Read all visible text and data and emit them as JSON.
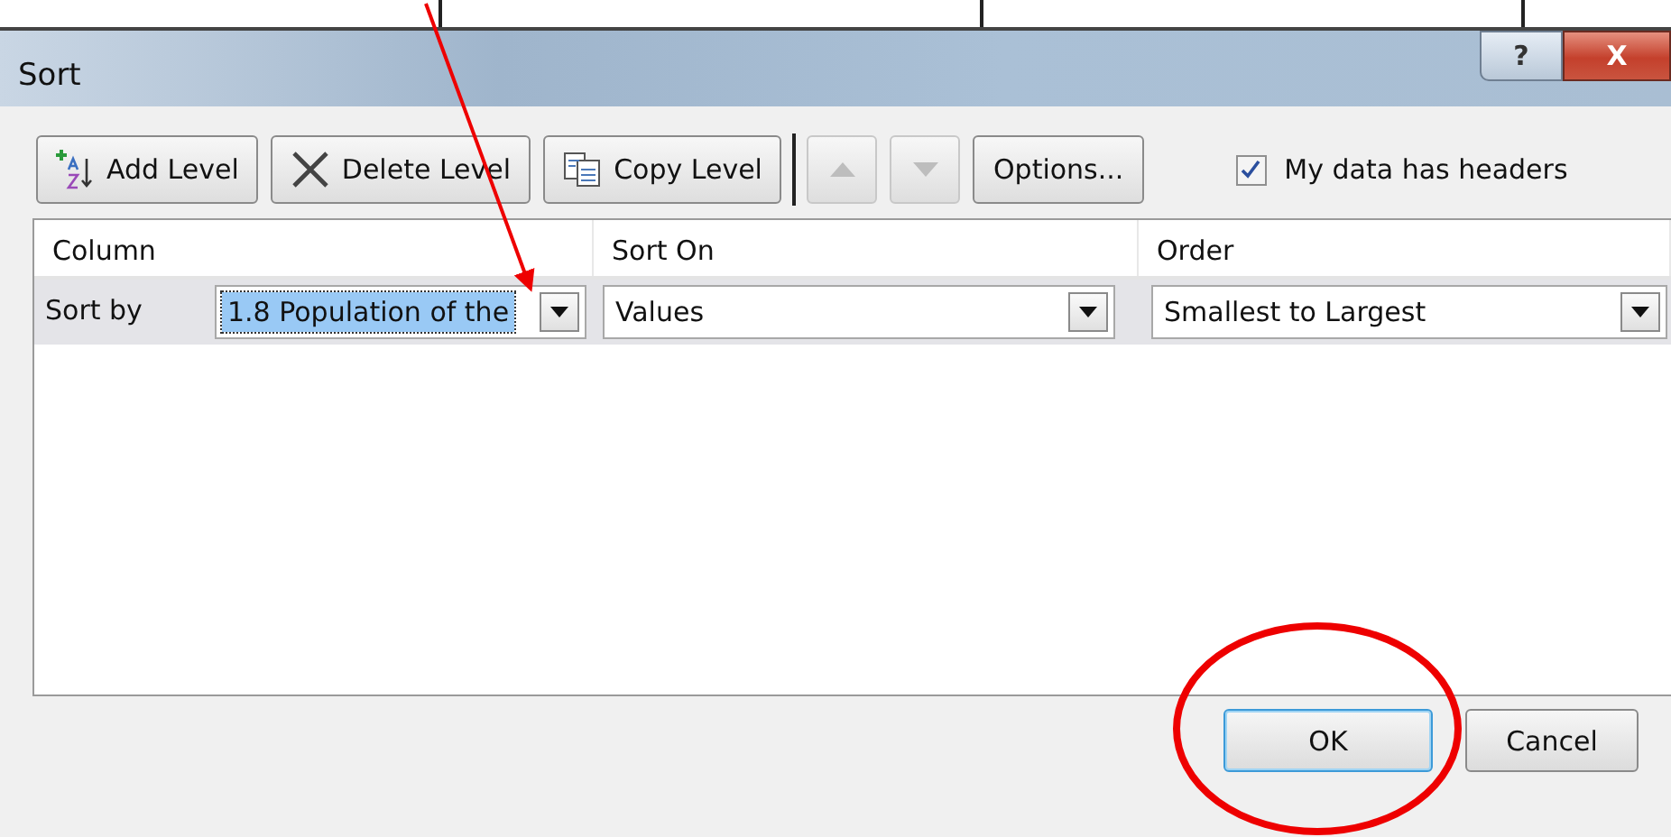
{
  "window": {
    "title": "Sort",
    "help_button": "?",
    "close_button": "X"
  },
  "toolbar": {
    "buttons": [
      {
        "kind": "add",
        "label": "Add Level",
        "disabled": false
      },
      {
        "kind": "delete",
        "label": "Delete Level",
        "disabled": false
      },
      {
        "kind": "copy",
        "label": "Copy Level",
        "disabled": false
      },
      {
        "kind": "up",
        "disabled": true
      },
      {
        "kind": "down",
        "disabled": true
      },
      {
        "kind": "options",
        "label": "Options...",
        "disabled": false
      }
    ],
    "headers_checkbox": {
      "label": "My data has headers",
      "checked": true
    }
  },
  "grid": {
    "columns": [
      "Column",
      "Sort On",
      "Order"
    ],
    "rows": [
      {
        "label": "Sort by",
        "column": "1.8 Population of the",
        "sort_on": "Values",
        "order": "Smallest to Largest",
        "selected": true
      }
    ]
  },
  "buttons": [
    {
      "label": "OK",
      "default": true
    },
    {
      "label": "Cancel",
      "default": false
    }
  ]
}
